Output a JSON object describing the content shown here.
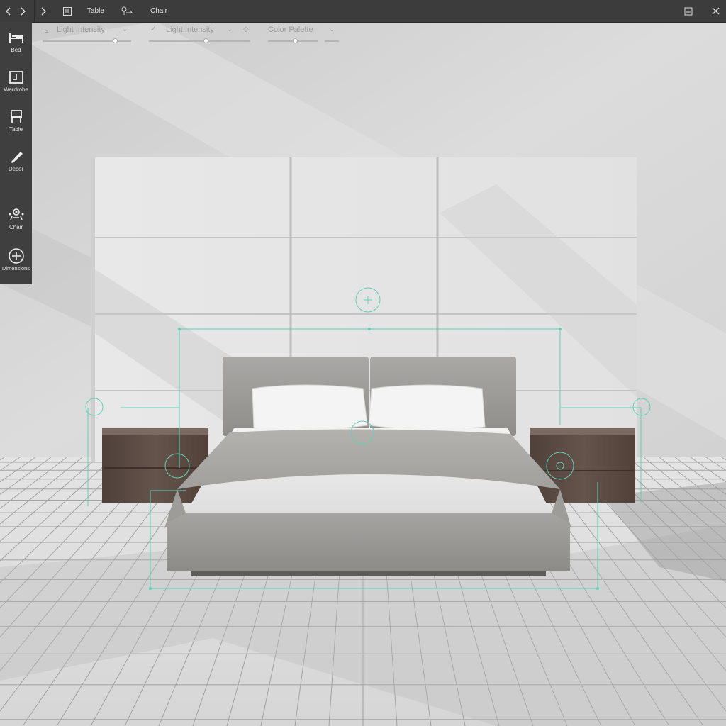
{
  "topbar": {
    "tab_table": "Table",
    "tab_chair": "Chair"
  },
  "toolbar": {
    "sliders": [
      {
        "label": "Light Intensity",
        "value": 0.8
      },
      {
        "label": "Light Intensity",
        "value": 0.56
      },
      {
        "label": "Color Palette",
        "value": 0.46
      }
    ]
  },
  "sidebar": {
    "items": [
      {
        "label": "Bed",
        "icon": "bed-icon"
      },
      {
        "label": "Wardrobe",
        "icon": "wardrobe-icon"
      },
      {
        "label": "Table",
        "icon": "table-icon"
      },
      {
        "label": "Decor",
        "icon": "decor-icon"
      },
      {
        "label": "Chair",
        "icon": "chair-icon"
      },
      {
        "label": "Dimensions",
        "icon": "add-icon"
      }
    ]
  },
  "colors": {
    "guide": "#5fd2b5",
    "wall": "#d8d8d8",
    "bed_frame": "#9d9b98",
    "nightstand": "#5b4a43"
  }
}
